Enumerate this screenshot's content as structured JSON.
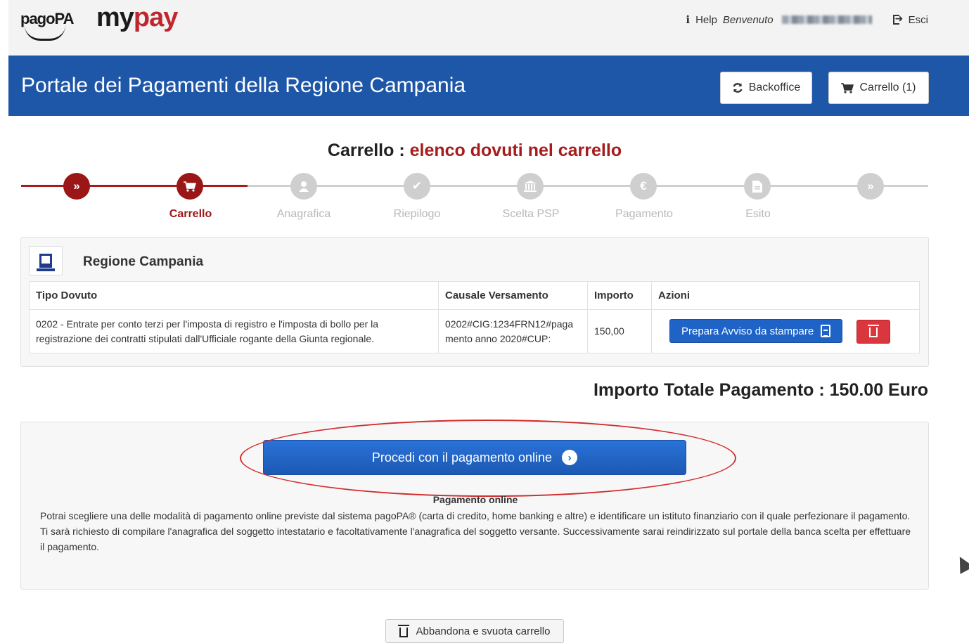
{
  "brand": {
    "pagopa": "pagoPA",
    "my": "my",
    "pay": "pay"
  },
  "topbar": {
    "help": "Help",
    "welcome": "Benvenuto",
    "logout": "Esci"
  },
  "header": {
    "title": "Portale dei Pagamenti della Regione Campania",
    "backoffice_label": "Backoffice",
    "cart_label": "Carrello (1)"
  },
  "page": {
    "title_prefix": "Carrello : ",
    "title_accent": "elenco dovuti nel carrello"
  },
  "stepper": {
    "steps": [
      {
        "label": "",
        "icon": "»",
        "state": "active"
      },
      {
        "label": "Carrello",
        "icon": "cart",
        "state": "active"
      },
      {
        "label": "Anagrafica",
        "icon": "user",
        "state": "todo"
      },
      {
        "label": "Riepilogo",
        "icon": "check",
        "state": "todo"
      },
      {
        "label": "Scelta PSP",
        "icon": "bank",
        "state": "todo"
      },
      {
        "label": "Pagamento",
        "icon": "euro",
        "state": "todo"
      },
      {
        "label": "Esito",
        "icon": "doc",
        "state": "todo"
      },
      {
        "label": "",
        "icon": "»",
        "state": "todo"
      }
    ]
  },
  "cart": {
    "entity": "Regione Campania",
    "columns": [
      "Tipo Dovuto",
      "Causale Versamento",
      "Importo",
      "Azioni"
    ],
    "rows": [
      {
        "tipo": "0202 - Entrate per conto terzi per l'imposta di registro e l'imposta di bollo per la registrazione dei contratti stipulati dall'Ufficiale rogante della Giunta regionale.",
        "causale": "0202#CIG:1234FRN12#pagamento anno 2020#CUP:",
        "importo": "150,00",
        "avviso_label": "Prepara Avviso da stampare"
      }
    ]
  },
  "total": {
    "label": "Importo Totale Pagamento : 150.00 Euro"
  },
  "payment": {
    "button_label": "Procedi con il pagamento online",
    "subtitle": "Pagamento online",
    "line1": "Potrai scegliere una delle modalità di pagamento online previste dal sistema pagoPA® (carta di credito, home banking e altre) e identificare un istituto finanziario con il quale perfezionare il pagamento.",
    "line2": "Ti sarà richiesto di compilare l'anagrafica del soggetto intestatario e facoltativamente l'anagrafica del soggetto versante. Successivamente sarai reindirizzato sul portale della banca scelta per effettuare il pagamento."
  },
  "abandon": {
    "label": "Abbandona e svuota carrello"
  },
  "colors": {
    "header_blue": "#1f57a8",
    "accent_red": "#a61c1c",
    "primary_blue": "#1f63c6",
    "danger_red": "#d9363e"
  }
}
